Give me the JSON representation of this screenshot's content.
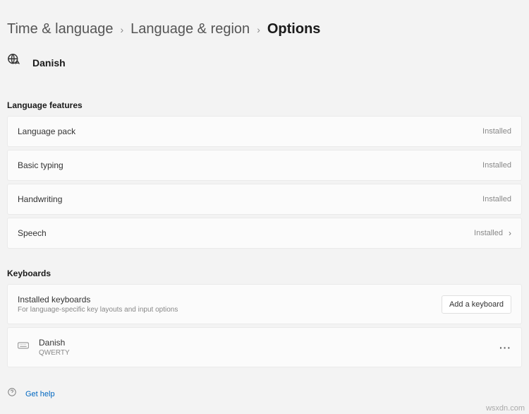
{
  "breadcrumb": {
    "item0": "Time & language",
    "item1": "Language & region",
    "item2": "Options"
  },
  "language": {
    "name": "Danish"
  },
  "sections": {
    "features_label": "Language features",
    "keyboards_label": "Keyboards"
  },
  "features": {
    "language_pack": {
      "title": "Language pack",
      "status": "Installed"
    },
    "basic_typing": {
      "title": "Basic typing",
      "status": "Installed"
    },
    "handwriting": {
      "title": "Handwriting",
      "status": "Installed"
    },
    "speech": {
      "title": "Speech",
      "status": "Installed"
    }
  },
  "keyboards": {
    "header_title": "Installed keyboards",
    "header_sub": "For language-specific key layouts and input options",
    "add_button": "Add a keyboard",
    "item0": {
      "name": "Danish",
      "layout": "QWERTY"
    }
  },
  "help": {
    "label": "Get help"
  },
  "watermark": "wsxdn.com"
}
